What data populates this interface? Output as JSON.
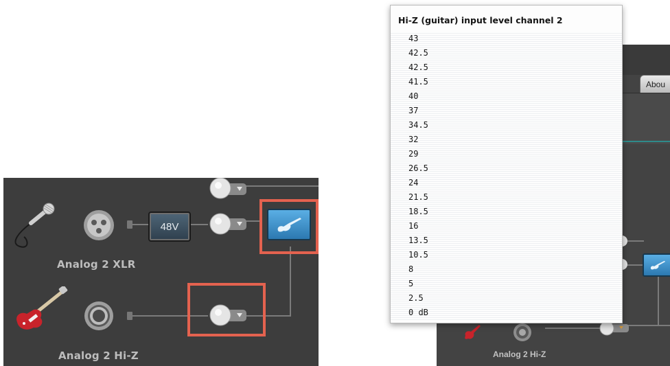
{
  "left_panel": {
    "btn_48v": "48V",
    "label_xlr": "Analog 2 XLR",
    "label_hiz": "Analog 2 Hi-Z"
  },
  "right_panel": {
    "tab_about": "Abou",
    "label_hiz": "Analog 2 Hi-Z"
  },
  "menu": {
    "title": "Hi-Z (guitar) input level channel 2",
    "items": [
      "43",
      "42.5",
      "42.5",
      "41.5",
      "40",
      "37",
      "34.5",
      "32",
      "29",
      "26.5",
      "24",
      "21.5",
      "18.5",
      "16",
      "13.5",
      "10.5",
      "8",
      "5",
      "2.5",
      "0 dB"
    ]
  },
  "colors": {
    "panel_bg": "#3d3d3d",
    "highlight": "#e4624f",
    "guitar_button": "#3c8ec9"
  },
  "icons": [
    "microphone-icon",
    "xlr-connector-icon",
    "quarter-inch-jack-icon",
    "guitar-icon",
    "knob-icon",
    "dropdown-arrow-icon"
  ]
}
